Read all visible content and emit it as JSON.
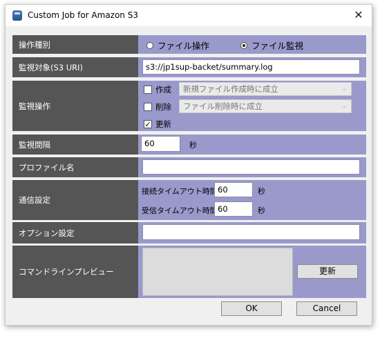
{
  "window": {
    "title": "Custom Job for Amazon S3",
    "close_glyph": "✕"
  },
  "operation_type": {
    "label": "操作種別",
    "options": [
      {
        "label": "ファイル操作",
        "selected": false
      },
      {
        "label": "ファイル監視",
        "selected": true
      }
    ]
  },
  "monitor_target": {
    "label": "監視対象(S3 URI)",
    "value": "s3://jp1sup-backet/summary.log"
  },
  "monitor_operation": {
    "label": "監視操作",
    "create": {
      "label": "作成",
      "checked": false,
      "select_value": "新規ファイル作成時に成立"
    },
    "delete": {
      "label": "削除",
      "checked": false,
      "select_value": "ファイル削除時に成立"
    },
    "update": {
      "label": "更新",
      "checked": true
    },
    "check_glyph": "✓"
  },
  "monitor_interval": {
    "label": "監視間隔",
    "value": "60",
    "unit": "秒"
  },
  "profile_name": {
    "label": "プロファイル名",
    "value": ""
  },
  "comm_settings": {
    "label": "通信設定",
    "connect_timeout": {
      "label": "接続タイムアウト時間",
      "value": "60",
      "unit": "秒"
    },
    "receive_timeout": {
      "label": "受信タイムアウト時間",
      "value": "60",
      "unit": "秒"
    }
  },
  "option_settings": {
    "label": "オプション設定",
    "value": ""
  },
  "command_preview": {
    "label": "コマンドラインプレビュー",
    "value": "",
    "refresh_label": "更新"
  },
  "footer": {
    "ok_label": "OK",
    "cancel_label": "Cancel"
  },
  "colors": {
    "label_bg": "#555555",
    "value_bg": "#9999cc",
    "dialog_bg": "#f0f0f0"
  }
}
